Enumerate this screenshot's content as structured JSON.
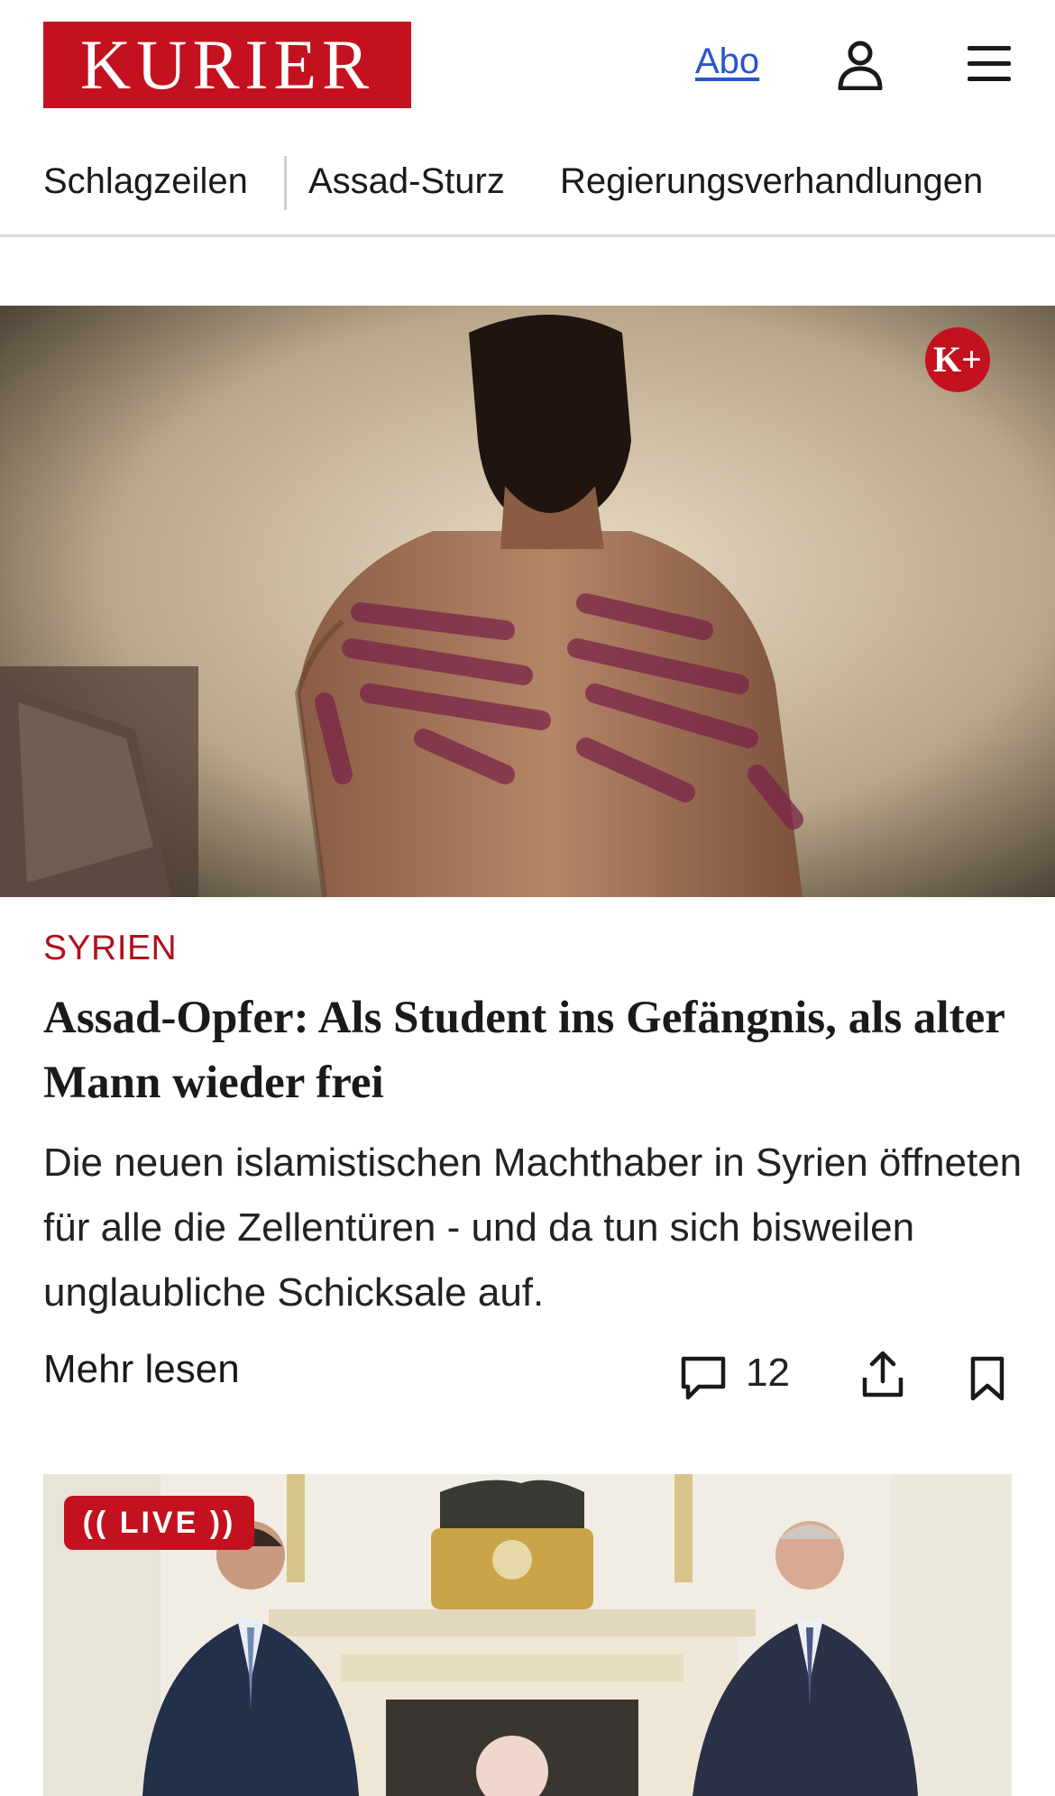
{
  "header": {
    "logo_text": "KURIER",
    "abo_label": "Abo",
    "user_icon": "user-icon",
    "menu_icon": "hamburger-menu-icon"
  },
  "nav": {
    "items": [
      {
        "label": "Schlagzeilen"
      },
      {
        "label": "Assad-Sturz"
      },
      {
        "label": "Regierungsverhandlungen"
      }
    ]
  },
  "article": {
    "premium_badge": "K+",
    "kicker": "SYRIEN",
    "headline": "Assad-Opfer: Als Student ins Gefängnis, als alter Mann wieder frei",
    "teaser": "Die neuen islamistischen Machthaber in Syrien öffneten für alle die Zellentüren - und da tun sich bisweilen unglaubliche Schicksale auf.",
    "more_label": "Mehr lesen",
    "comment_count": "12"
  },
  "second_article": {
    "live_label": "LIVE"
  },
  "colors": {
    "brand_red": "#c4111f",
    "kicker_red": "#b0101c",
    "link_blue": "#2756c9"
  }
}
